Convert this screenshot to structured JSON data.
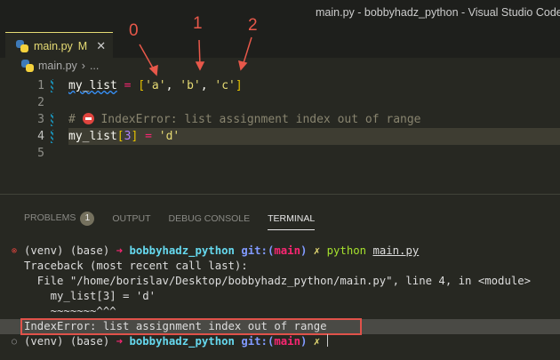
{
  "window": {
    "title": "main.py - bobbyhadz_python - Visual Studio Code"
  },
  "tab": {
    "label": "main.py",
    "status": "M",
    "close": "✕"
  },
  "breadcrumb": {
    "file": "main.py",
    "sep": "›",
    "rest": "..."
  },
  "editor": {
    "line_numbers": [
      "1",
      "2",
      "3",
      "4",
      "5"
    ],
    "line1": {
      "var": "my_list",
      "eq": " = ",
      "open": "[",
      "a": "'a'",
      "c1": ", ",
      "b": "'b'",
      "c2": ", ",
      "c": "'c'",
      "close": "]"
    },
    "line3": {
      "hash": "# ",
      "text": " IndexError: list assignment index out of range"
    },
    "line4": {
      "var": "my_list",
      "open": "[",
      "idx": "3",
      "close": "]",
      "eq": " = ",
      "val": "'d'"
    }
  },
  "annotations": [
    "0",
    "1",
    "2"
  ],
  "panel": {
    "tabs": [
      "PROBLEMS",
      "OUTPUT",
      "DEBUG CONSOLE",
      "TERMINAL"
    ],
    "problems_count": "1"
  },
  "terminal": {
    "prompt": {
      "venv": "(venv) (base) ",
      "arrow": "➜ ",
      "dir": "bobbyhadz_python",
      "git": " git:(",
      "branch": "main",
      "gitclose": ")",
      "dirty": " ✗ "
    },
    "cmd": "python",
    "arg": "main.py",
    "lines": [
      "Traceback (most recent call last):",
      "  File \"/home/borislav/Desktop/bobbyhadz_python/main.py\", line 4, in <module>",
      "    my_list[3] = 'd'",
      "    ~~~~~~~^^^",
      "IndexError: list assignment index out of range"
    ]
  },
  "colors": {
    "accent": "#e6db74",
    "error_box": "#e0524a"
  }
}
